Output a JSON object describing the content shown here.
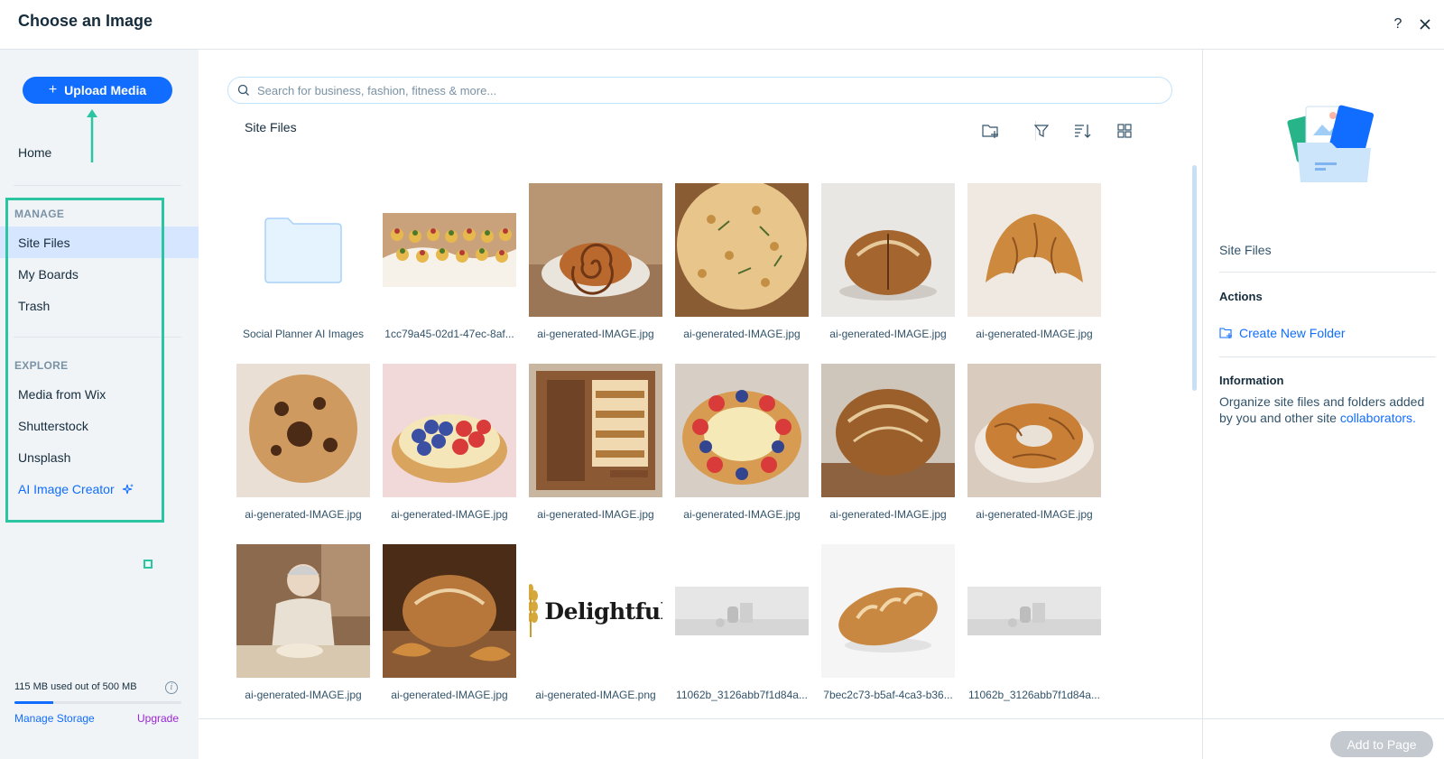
{
  "header": {
    "title": "Choose an Image",
    "help_label": "?"
  },
  "sidebar": {
    "upload_label": "Upload Media",
    "home_label": "Home",
    "manage_section": "MANAGE",
    "manage_items": [
      "Site Files",
      "My Boards",
      "Trash"
    ],
    "explore_section": "EXPLORE",
    "explore_items": [
      "Media from Wix",
      "Shutterstock",
      "Unsplash"
    ],
    "ai_creator_label": "AI Image Creator",
    "storage": {
      "text": "115 MB used out of 500 MB",
      "used_fraction": 0.23
    },
    "manage_storage_label": "Manage Storage",
    "upgrade_label": "Upgrade"
  },
  "main": {
    "search_placeholder": "Search for business, fashion, fitness & more...",
    "breadcrumb": "Site Files",
    "items": [
      {
        "caption": "Social Planner AI Images",
        "kind": "folder"
      },
      {
        "caption": "1cc79a45-02d1-47ec-8af...",
        "kind": "canapes"
      },
      {
        "caption": "ai-generated-IMAGE.jpg",
        "kind": "cinnamon-roll"
      },
      {
        "caption": "ai-generated-IMAGE.jpg",
        "kind": "focaccia"
      },
      {
        "caption": "ai-generated-IMAGE.jpg",
        "kind": "sourdough"
      },
      {
        "caption": "ai-generated-IMAGE.jpg",
        "kind": "croissant"
      },
      {
        "caption": "ai-generated-IMAGE.jpg",
        "kind": "cookie"
      },
      {
        "caption": "ai-generated-IMAGE.jpg",
        "kind": "berry-tart"
      },
      {
        "caption": "ai-generated-IMAGE.jpg",
        "kind": "bakery-storefront"
      },
      {
        "caption": "ai-generated-IMAGE.jpg",
        "kind": "fruit-tart"
      },
      {
        "caption": "ai-generated-IMAGE.jpg",
        "kind": "rustic-loaf"
      },
      {
        "caption": "ai-generated-IMAGE.jpg",
        "kind": "pastry-ring"
      },
      {
        "caption": "ai-generated-IMAGE.jpg",
        "kind": "baker"
      },
      {
        "caption": "ai-generated-IMAGE.jpg",
        "kind": "bread-croissants"
      },
      {
        "caption": "ai-generated-IMAGE.png",
        "kind": "logo",
        "logo_text": "Delightful"
      },
      {
        "caption": "11062b_3126abb7f1d84a...",
        "kind": "gray-objects"
      },
      {
        "caption": "7bec2c73-b5af-4ca3-b36...",
        "kind": "baguette"
      },
      {
        "caption": "11062b_3126abb7f1d84a...",
        "kind": "gray-objects"
      }
    ]
  },
  "right_panel": {
    "title": "Site Files",
    "actions_heading": "Actions",
    "create_folder_label": "Create New Folder",
    "info_heading": "Information",
    "info_text": "Organize site files and folders added by you and other site ",
    "info_link": "collaborators."
  },
  "footer": {
    "add_to_page_label": "Add to Page"
  },
  "colors": {
    "accent": "#116dff",
    "annotation": "#2cc5a2",
    "sidebar_bg": "#f0f4f7"
  }
}
